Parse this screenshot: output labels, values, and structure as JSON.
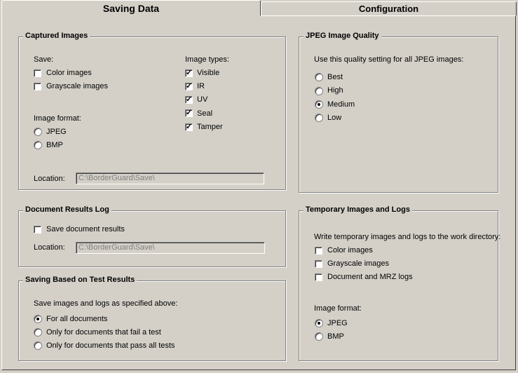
{
  "tabs": [
    {
      "label": "Saving Data",
      "active": true
    },
    {
      "label": "Configuration",
      "active": false
    }
  ],
  "captured_images": {
    "title": "Captured Images",
    "save_label": "Save:",
    "save_options": [
      {
        "label": "Color images",
        "checked": false
      },
      {
        "label": "Grayscale images",
        "checked": false
      }
    ],
    "image_types_label": "Image types:",
    "image_types": [
      {
        "label": "Visible",
        "checked": true
      },
      {
        "label": "IR",
        "checked": true
      },
      {
        "label": "UV",
        "checked": true
      },
      {
        "label": "Seal",
        "checked": true
      },
      {
        "label": "Tamper",
        "checked": true
      }
    ],
    "format_label": "Image format:",
    "formats": [
      {
        "label": "JPEG",
        "selected": false
      },
      {
        "label": "BMP",
        "selected": false
      }
    ],
    "location_label": "Location:",
    "location_value": "C:\\BorderGuard\\Save\\"
  },
  "jpeg_quality": {
    "title": "JPEG Image Quality",
    "description": "Use this quality setting for all JPEG images:",
    "options": [
      {
        "label": "Best",
        "selected": false
      },
      {
        "label": "High",
        "selected": false
      },
      {
        "label": "Medium",
        "selected": true
      },
      {
        "label": "Low",
        "selected": false
      }
    ]
  },
  "document_results": {
    "title": "Document Results Log",
    "save_label": "Save document results",
    "save_checked": false,
    "location_label": "Location:",
    "location_value": "C:\\BorderGuard\\Save\\"
  },
  "temporary": {
    "title": "Temporary Images and Logs",
    "description": "Write temporary images and logs to the work directory:",
    "options": [
      {
        "label": "Color images",
        "checked": false
      },
      {
        "label": "Grayscale images",
        "checked": false
      },
      {
        "label": "Document and MRZ logs",
        "checked": false
      }
    ],
    "format_label": "Image format:",
    "formats": [
      {
        "label": "JPEG",
        "selected": true
      },
      {
        "label": "BMP",
        "selected": false
      }
    ]
  },
  "test_results": {
    "title": "Saving Based on Test Results",
    "description": "Save images and logs as specified above:",
    "options": [
      {
        "label": "For all documents",
        "selected": true
      },
      {
        "label": "Only for documents that fail a test",
        "selected": false
      },
      {
        "label": "Only for documents that pass all tests",
        "selected": false
      }
    ]
  }
}
